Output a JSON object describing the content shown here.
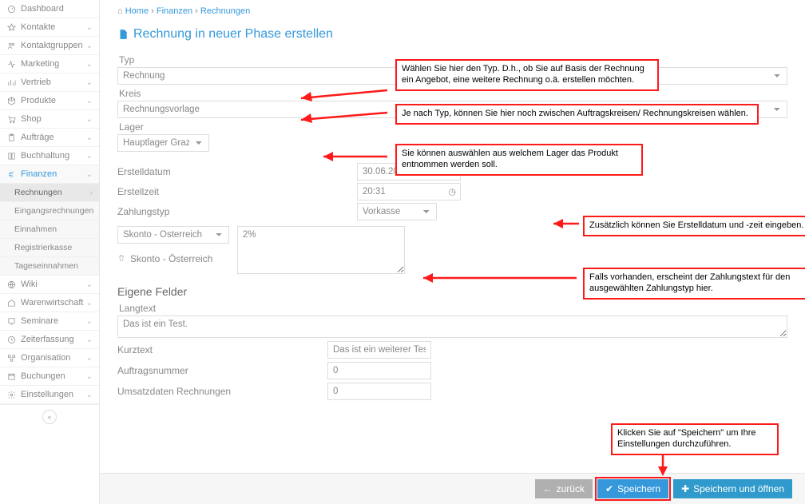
{
  "breadcrumb": {
    "home": "Home",
    "finanzen": "Finanzen",
    "rechnungen": "Rechnungen"
  },
  "page_title": "Rechnung in neuer Phase erstellen",
  "sidebar": {
    "items": [
      {
        "label": "Dashboard"
      },
      {
        "label": "Kontakte"
      },
      {
        "label": "Kontaktgruppen"
      },
      {
        "label": "Marketing"
      },
      {
        "label": "Vertrieb"
      },
      {
        "label": "Produkte"
      },
      {
        "label": "Shop"
      },
      {
        "label": "Aufträge"
      },
      {
        "label": "Buchhaltung"
      },
      {
        "label": "Finanzen"
      },
      {
        "label": "Wiki"
      },
      {
        "label": "Warenwirtschaft"
      },
      {
        "label": "Seminare"
      },
      {
        "label": "Zeiterfassung"
      },
      {
        "label": "Organisation"
      },
      {
        "label": "Buchungen"
      },
      {
        "label": "Einstellungen"
      }
    ],
    "sub": [
      {
        "label": "Rechnungen"
      },
      {
        "label": "Eingangsrechnungen"
      },
      {
        "label": "Einnahmen"
      },
      {
        "label": "Registrierkasse"
      },
      {
        "label": "Tageseinnahmen"
      }
    ]
  },
  "form": {
    "typ_label": "Typ",
    "typ_value": "Rechnung",
    "kreis_label": "Kreis",
    "kreis_value": "Rechnungsvorlage",
    "lager_label": "Lager",
    "lager_value": "Hauptlager Graz",
    "erstelldatum_label": "Erstelldatum",
    "erstelldatum_value": "30.06.2020",
    "erstellzeit_label": "Erstellzeit",
    "erstellzeit_value": "20:31",
    "zahlungstyp_label": "Zahlungstyp",
    "zahlungstyp_value": "Vorkasse",
    "skonto_select_value": "Skonto - Österreich",
    "skonto_label": "Skonto - Österreich",
    "skonto_text": "2%"
  },
  "eigene_felder": {
    "title": "Eigene Felder",
    "langtext_label": "Langtext",
    "langtext_value": "Das ist ein Test.",
    "kurztext_label": "Kurztext",
    "kurztext_value": "Das ist ein weiterer Test",
    "auftragsnummer_label": "Auftragsnummer",
    "auftragsnummer_value": "0",
    "umsatzdaten_label": "Umsatzdaten Rechnungen",
    "umsatzdaten_value": "0"
  },
  "buttons": {
    "back": "zurück",
    "save": "Speichern",
    "save_open": "Speichern und öffnen"
  },
  "annotations": {
    "typ": "Wählen Sie hier den Typ. D.h., ob Sie auf Basis der Rechnung ein Angebot, eine weitere Rechnung o.ä. erstellen möchten.",
    "kreis": "Je nach Typ, können Sie hier noch zwischen Auftragskreisen/ Rechnungskreisen wählen.",
    "lager": "Sie können auswählen aus welchem Lager das Produkt entnommen werden soll.",
    "zeit": "Zusätzlich können Sie Erstelldatum und -zeit eingeben.",
    "zahlungstext": "Falls vorhanden, erscheint der Zahlungstext für den ausgewählten Zahlungstyp hier.",
    "speichern": "Klicken Sie auf \"Speichern\" um Ihre Einstellungen durchzuführen."
  }
}
